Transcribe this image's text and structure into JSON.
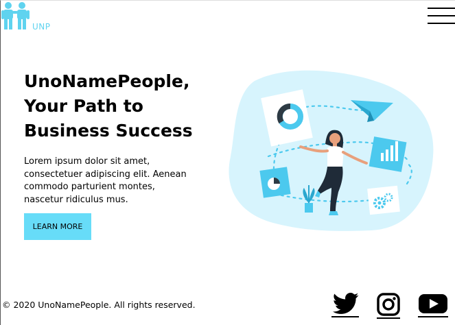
{
  "brand": {
    "name": "UNP",
    "accent": "#5fd3ef"
  },
  "nav": {
    "menu_icon": "hamburger-icon"
  },
  "hero": {
    "title_lines": [
      "UnoNamePeople,",
      "Your Path to",
      "Business Success"
    ],
    "text_lines": [
      "Lorem ipsum dolor sit amet,",
      "consectetuer adipiscing elit. Aenean",
      "commodo parturient montes,",
      "nascetur ridiculus mus."
    ],
    "cta_label": "LEARN MORE",
    "cta_color": "#67dcf8",
    "illustration": "business-person-illustration"
  },
  "footer": {
    "copyright": "© 2020 UnoNamePeople. All rights reserved.",
    "social": [
      "twitter-icon",
      "instagram-icon",
      "youtube-icon"
    ]
  }
}
